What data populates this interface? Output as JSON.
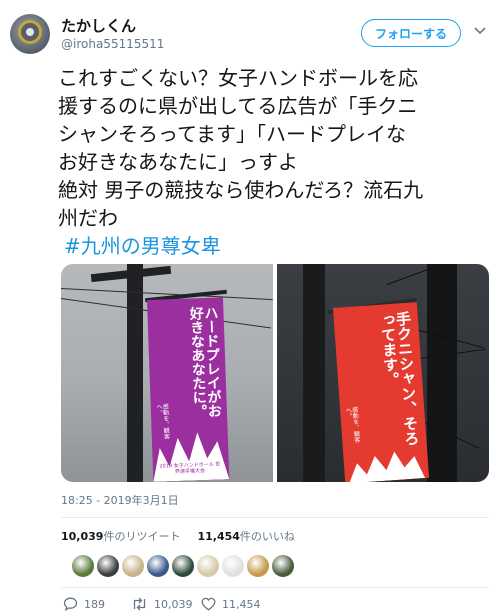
{
  "user": {
    "display_name": "たかしくん",
    "handle": "@iroha55115511"
  },
  "follow_button": {
    "label": "フォローする"
  },
  "tweet": {
    "lines": [
      "これすごくない？女子ハンドボールを応",
      "援するのに県が出してる広告が「手クニ",
      "シャンそろってます」「ハードプレイな",
      "お好きなあなたに」っすよ",
      "絶対 男子の競技なら使わんだろ？流石九",
      "州だわ"
    ],
    "hashtag": "#九州の男尊女卑"
  },
  "photos": {
    "left": {
      "banner_text_main": "ハードプレイがお好きなあなたに。",
      "banner_small": "2019 女子ハンドボール 世界選手権大会",
      "banner_side": "感動を、観客へ。",
      "banner_color": "#9b2fa0"
    },
    "right": {
      "banner_text_main": "手クニシャン、そろってます。",
      "banner_side": "感動を、観客へ。",
      "banner_color": "#e43a2f"
    }
  },
  "timestamp": "18:25 - 2019年3月1日",
  "stats": {
    "retweets_count": "10,039",
    "retweets_label": "件のリツイート",
    "likes_count": "11,454",
    "likes_label": "件のいいね"
  },
  "likers": [
    {
      "name": "liker-avatar-1",
      "color": "#5a7a3c"
    },
    {
      "name": "liker-avatar-2",
      "color": "#3a3d40"
    },
    {
      "name": "liker-avatar-3",
      "color": "#c8b28a"
    },
    {
      "name": "liker-avatar-4",
      "color": "#3a5a8a"
    },
    {
      "name": "liker-avatar-5",
      "color": "#2c4a3a"
    },
    {
      "name": "liker-avatar-6",
      "color": "#d6c9a8"
    },
    {
      "name": "liker-avatar-7",
      "color": "#e0e0e0"
    },
    {
      "name": "liker-avatar-8",
      "color": "#c49a4a"
    },
    {
      "name": "liker-avatar-9",
      "color": "#4a5b3c"
    }
  ],
  "actions": {
    "reply_count": "189",
    "retweet_count": "10,039",
    "like_count": "11,454"
  },
  "colors": {
    "accent": "#1da1f2",
    "hashtag": "#1b95e0",
    "secondary_text": "#657786"
  }
}
